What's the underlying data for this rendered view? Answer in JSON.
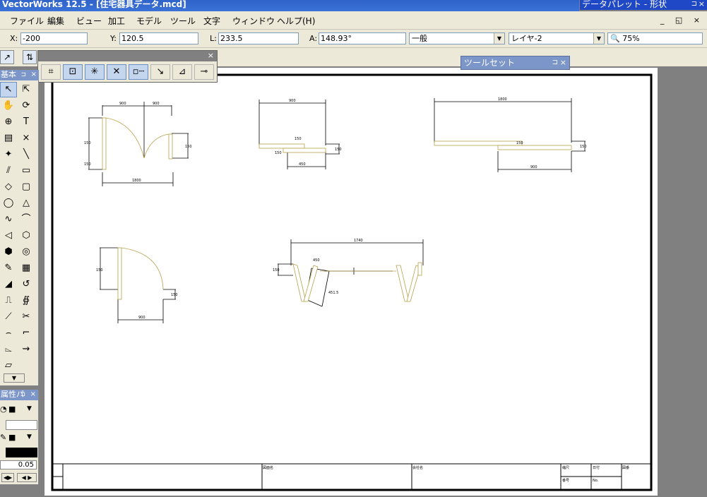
{
  "window": {
    "title": "VectorWorks 12.5 - [住宅器具データ.mcd]"
  },
  "data_palette": {
    "title": "データパレット - 形状",
    "pin_glyph": "⊐",
    "close_glyph": "×"
  },
  "menu": {
    "items": [
      "ファイル",
      "編集",
      "ビュー",
      "加工",
      "モデル",
      "ツール",
      "文字",
      "ウィンドウ",
      "ヘルプ(H)"
    ],
    "mdi_controls": "_ ◱ ×"
  },
  "data_bar": {
    "x_label": "X:",
    "x_value": "-200",
    "y_label": "Y:",
    "y_value": "120.5",
    "l_label": "L:",
    "l_value": "233.5",
    "a_label": "A:",
    "a_value": "148.93°",
    "class_value": "一般",
    "layer_value": "レイヤ-2",
    "zoom_value": "75%",
    "dropdown_glyph": "▼",
    "zoom_glyph": "🔍"
  },
  "constraint_palette": {
    "close_glyph": "×"
  },
  "toolset_palette": {
    "title": "ツールセット",
    "pin_glyph": "⊐",
    "close_glyph": "×"
  },
  "tool_palette": {
    "title": "基本",
    "pin_glyph": "⊐",
    "close_glyph": "×",
    "tools": [
      {
        "glyph": "↖",
        "icon": "selection-icon"
      },
      {
        "glyph": "⇱",
        "icon": "reshape-icon"
      },
      {
        "glyph": "✋",
        "icon": "pan-icon"
      },
      {
        "glyph": "⟳",
        "icon": "flyover-icon"
      },
      {
        "glyph": "⊕",
        "icon": "zoom-icon"
      },
      {
        "glyph": "T",
        "icon": "text-icon"
      },
      {
        "glyph": "▤",
        "icon": "callout-icon"
      },
      {
        "glyph": "×",
        "icon": "locus-icon"
      },
      {
        "glyph": "✦",
        "icon": "3d-locus-icon"
      },
      {
        "glyph": "╲",
        "icon": "line-icon"
      },
      {
        "glyph": "⫽",
        "icon": "double-line-icon"
      },
      {
        "glyph": "▭",
        "icon": "rectangle-icon"
      },
      {
        "glyph": "◇",
        "icon": "rotated-rectangle-icon"
      },
      {
        "glyph": "▢",
        "icon": "rounded-rectangle-icon"
      },
      {
        "glyph": "◯",
        "icon": "oval-icon"
      },
      {
        "glyph": "△",
        "icon": "triangle-icon"
      },
      {
        "glyph": "∿",
        "icon": "freehand-icon"
      },
      {
        "glyph": "⌒",
        "icon": "polyline-icon"
      },
      {
        "glyph": "◁",
        "icon": "polygon-icon"
      },
      {
        "glyph": "⬡",
        "icon": "double-line-polygon-icon"
      },
      {
        "glyph": "⬢",
        "icon": "regular-polygon-icon"
      },
      {
        "glyph": "◎",
        "icon": "spiral-icon"
      },
      {
        "glyph": "✎",
        "icon": "eyedropper-icon"
      },
      {
        "glyph": "▦",
        "icon": "attribute-mapping-icon"
      },
      {
        "glyph": "◢",
        "icon": "fillet-icon"
      },
      {
        "glyph": "↺",
        "icon": "rotate-icon"
      },
      {
        "glyph": "⎍",
        "icon": "mirror-icon"
      },
      {
        "glyph": "∯",
        "icon": "offset-icon"
      },
      {
        "glyph": "⟋",
        "icon": "chamfer-icon"
      },
      {
        "glyph": "✂",
        "icon": "trim-icon"
      },
      {
        "glyph": "⌢",
        "icon": "arc-icon"
      },
      {
        "glyph": "⌐",
        "icon": "corner-icon"
      },
      {
        "glyph": "⌳",
        "icon": "connect-icon"
      },
      {
        "glyph": "⇝",
        "icon": "split-icon"
      },
      {
        "glyph": "▱",
        "icon": "eraser-icon"
      }
    ],
    "more_glyph": "▼"
  },
  "attributes_palette": {
    "title": "属性パ",
    "pin_glyph": "⊐",
    "close_glyph": "×",
    "line_weight": "0.05",
    "nav_prev": "◀▶",
    "nav_next": "◀ ▶"
  },
  "titleblock": {
    "cells": [
      "図面名",
      "会社名",
      "縮尺",
      "日付",
      "図番",
      "番号",
      "No."
    ]
  },
  "dims": {
    "d1": "900",
    "d2": "900",
    "d3": "1800",
    "d4": "150",
    "d5": "150",
    "d6": "150",
    "d7": "900",
    "d8": "150",
    "d9": "450",
    "d10": "150",
    "d11": "150",
    "d12": "1800",
    "d13": "150",
    "d14": "900",
    "d15": "150",
    "d16": "150",
    "d17": "900",
    "d18": "150",
    "d19": "1740",
    "d20": "150",
    "d21": "450",
    "d22": "451.5"
  },
  "colors": {
    "titlebar": "#2f63c9",
    "menubg": "#ece9d8",
    "palette_title": "#7c96c9",
    "selection_blue": "#c4d5ee",
    "door_swing": "#b8a04a",
    "canvas_bg": "#808080"
  }
}
